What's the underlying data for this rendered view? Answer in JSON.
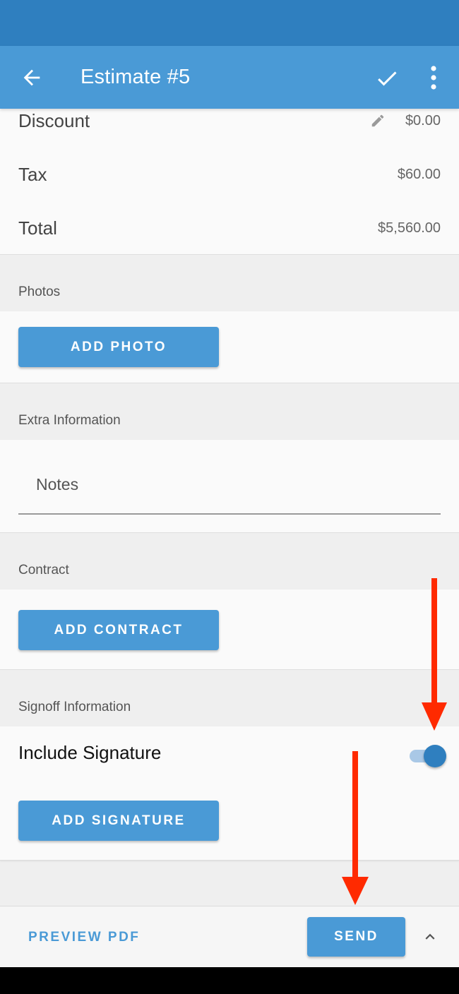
{
  "app_bar": {
    "title": "Estimate #5",
    "back_icon": "arrow-left-icon",
    "save_icon": "check-icon",
    "menu_icon": "more-vert-icon"
  },
  "totals": {
    "rows": [
      {
        "label": "Discount",
        "value": "$0.00",
        "editable": true
      },
      {
        "label": "Tax",
        "value": "$60.00"
      },
      {
        "label": "Total",
        "value": "$5,560.00"
      }
    ]
  },
  "sections": {
    "photos": {
      "header": "Photos",
      "button": "ADD PHOTO"
    },
    "extra": {
      "header": "Extra Information",
      "notes_placeholder": "Notes"
    },
    "contract": {
      "header": "Contract",
      "button": "ADD CONTRACT"
    },
    "signoff": {
      "header": "Signoff Information",
      "include_label": "Include Signature",
      "include_on": true,
      "button": "ADD SIGNATURE"
    }
  },
  "bottom_bar": {
    "preview_label": "PREVIEW PDF",
    "send_label": "SEND",
    "expand_icon": "chevron-up-icon"
  },
  "colors": {
    "primary": "#4a9ad6",
    "primary_dark": "#2f7fbf",
    "annotation": "#ff2a00"
  }
}
